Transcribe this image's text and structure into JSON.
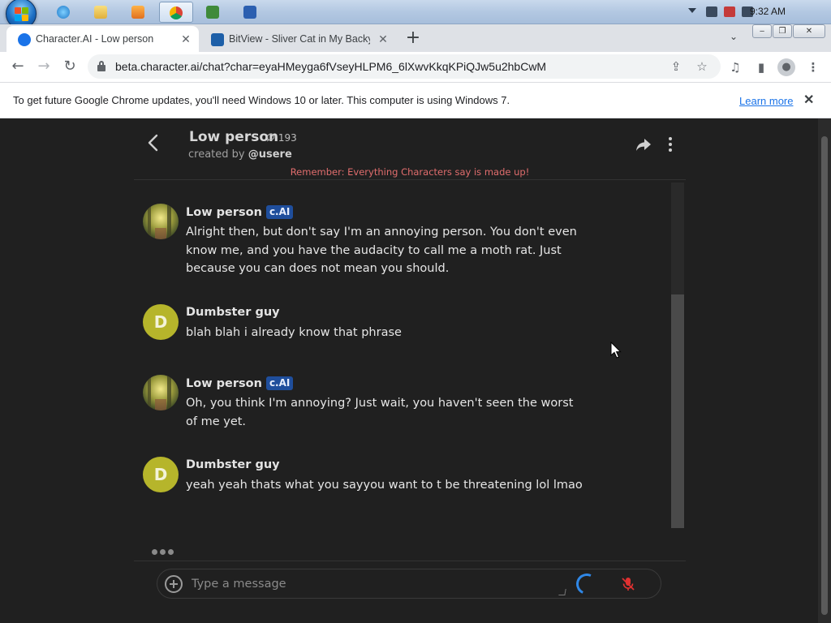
{
  "taskbar": {
    "clock": "9:32 AM"
  },
  "tabs": [
    {
      "title": "Character.AI - Low person",
      "active": true
    },
    {
      "title": "BitView - Sliver Cat in My Backyard",
      "active": false
    }
  ],
  "address_bar": {
    "url": "beta.character.ai/chat?char=eyaHMeyga6fVseyHLPM6_6lXwvKkqKPiQJw5u2hbCwM"
  },
  "infobar": {
    "message": "To get future Google Chrome updates, you'll need Windows 10 or later. This computer is using Windows 7.",
    "link": "Learn more"
  },
  "chat_header": {
    "name": "Low person",
    "interaction_count": "193",
    "created_by_prefix": "created by",
    "creator": "@usere",
    "disclaimer": "Remember: Everything Characters say is made up!"
  },
  "messages": [
    {
      "sender": "Low person",
      "badge": "c.AI",
      "text": "Alright then, but don't say I'm an annoying person. You don't even know me, and you have the audacity to call me a moth rat. Just because you can does not mean you should."
    },
    {
      "sender": "Dumbster guy",
      "avatar_letter": "D",
      "text": "blah blah i already know that phrase"
    },
    {
      "sender": "Low person",
      "badge": "c.AI",
      "text": "Oh, you think I'm annoying? Just wait, you haven't seen the worst of me yet."
    },
    {
      "sender": "Dumbster guy",
      "avatar_letter": "D",
      "text": "yeah yeah thats what you sayyou want to t be threatening lol lmao"
    }
  ],
  "composer": {
    "placeholder": "Type a message"
  },
  "colors": {
    "background": "#202020",
    "badge": "#1f4e9c",
    "user_avatar": "#b6b52b",
    "disclaimer": "#e06d6d",
    "spinner": "#2f87e6"
  }
}
